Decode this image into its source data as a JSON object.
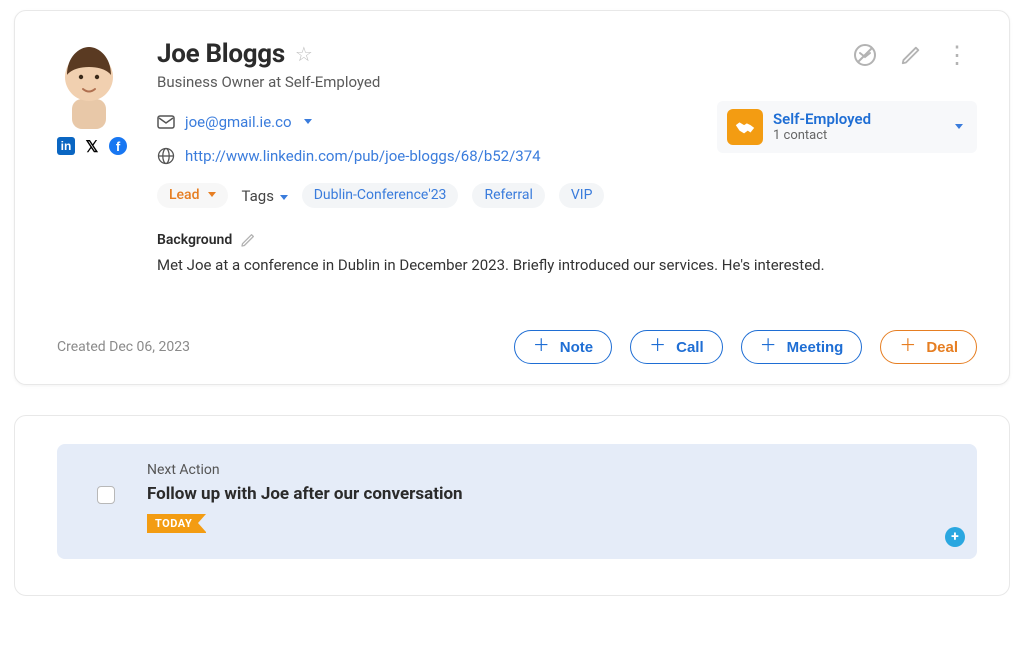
{
  "contact": {
    "name": "Joe Bloggs",
    "subtitle": "Business Owner at Self-Employed",
    "email": "joe@gmail.ie.co",
    "url": "http://www.linkedin.com/pub/joe-bloggs/68/b52/374",
    "status_label": "Lead",
    "tags_label": "Tags",
    "tags": [
      "Dublin-Conference'23",
      "Referral",
      "VIP"
    ],
    "background_label": "Background",
    "background_text": "Met Joe at a conference in Dublin in December 2023. Briefly introduced our services. He's interested.",
    "created_label": "Created Dec 06, 2023"
  },
  "company": {
    "name": "Self-Employed",
    "subtitle": "1 contact"
  },
  "buttons": {
    "note": "Note",
    "call": "Call",
    "meeting": "Meeting",
    "deal": "Deal"
  },
  "next_action": {
    "section_label": "Next Action",
    "task": "Follow up with Joe after our conversation",
    "badge": "TODAY"
  },
  "icons": {
    "linkedin": "in",
    "x": "X",
    "facebook": "f"
  }
}
